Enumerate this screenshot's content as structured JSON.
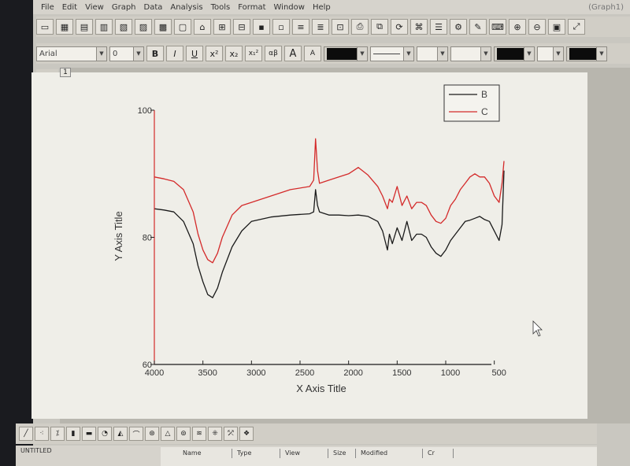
{
  "menu": [
    "File",
    "Edit",
    "View",
    "Graph",
    "Data",
    "Analysis",
    "Tools",
    "Format",
    "Window",
    "Help"
  ],
  "window_title_right": "(Graph1)",
  "format_toolbar": {
    "font_name": "Arial",
    "font_size": "0",
    "bold": "B",
    "italic": "I",
    "underline": "U",
    "superscript": "x²",
    "subscript": "x₂",
    "supsub": "x₁²",
    "greek": "αβ",
    "increase_font": "A",
    "decrease_font": "A"
  },
  "layer_label": "1",
  "project": {
    "name": "UNTITLED",
    "columns": [
      "Name",
      "Type",
      "View",
      "Size",
      "Modified"
    ],
    "dropdown": "Cr"
  },
  "chart_data": {
    "type": "line",
    "xlabel": "X Axis Title",
    "ylabel": "Y Axis Title",
    "xlim": [
      4000,
      400
    ],
    "ylim": [
      60,
      100
    ],
    "x_ticks": [
      4000,
      3500,
      3000,
      2500,
      2000,
      1500,
      1000,
      500
    ],
    "x_tick_labels": [
      "4000",
      "3500",
      "3000",
      "2500",
      "2000",
      "1500",
      "1000",
      "500"
    ],
    "y_ticks": [
      60,
      80,
      100
    ],
    "y_tick_labels": [
      "60",
      "80",
      "100"
    ],
    "grid": false,
    "legend_position": "top-right",
    "series": [
      {
        "name": "B",
        "color": "#1a1a1a",
        "x": [
          4000,
          3900,
          3800,
          3700,
          3600,
          3550,
          3500,
          3450,
          3400,
          3350,
          3300,
          3200,
          3100,
          3000,
          2800,
          2600,
          2400,
          2360,
          2340,
          2320,
          2300,
          2200,
          2100,
          2000,
          1900,
          1800,
          1700,
          1650,
          1600,
          1580,
          1550,
          1500,
          1450,
          1400,
          1350,
          1300,
          1250,
          1200,
          1150,
          1100,
          1050,
          1000,
          950,
          900,
          850,
          800,
          750,
          700,
          650,
          600,
          550,
          500,
          450,
          420,
          400
        ],
        "y": [
          84.5,
          84.3,
          84,
          82.5,
          79,
          75.5,
          73,
          71,
          70.5,
          72,
          74.5,
          78.5,
          81,
          82.5,
          83.2,
          83.5,
          83.7,
          84,
          87.5,
          85,
          84,
          83.5,
          83.5,
          83.4,
          83.5,
          83.3,
          82.5,
          81,
          78,
          80.5,
          79,
          81.5,
          79.5,
          82.5,
          79.5,
          80.5,
          80.5,
          80,
          78.5,
          77.5,
          77,
          78,
          79.5,
          80.5,
          81.5,
          82.5,
          82.7,
          83,
          83.3,
          82.8,
          82.5,
          81,
          79.5,
          82,
          90.5
        ]
      },
      {
        "name": "C",
        "color": "#d42a2a",
        "x": [
          4000,
          3900,
          3800,
          3700,
          3600,
          3550,
          3500,
          3450,
          3400,
          3350,
          3300,
          3200,
          3100,
          3000,
          2800,
          2600,
          2400,
          2360,
          2340,
          2320,
          2300,
          2200,
          2100,
          2000,
          1900,
          1800,
          1700,
          1650,
          1600,
          1580,
          1550,
          1500,
          1450,
          1400,
          1350,
          1300,
          1250,
          1200,
          1150,
          1100,
          1050,
          1000,
          950,
          900,
          850,
          800,
          750,
          700,
          650,
          600,
          550,
          500,
          450,
          420,
          400
        ],
        "y": [
          89.5,
          89.2,
          88.8,
          87.5,
          84,
          80.5,
          78,
          76.5,
          76,
          77.5,
          80,
          83.5,
          85,
          85.5,
          86.5,
          87.5,
          88,
          89,
          95.5,
          90.5,
          88.5,
          89,
          89.5,
          90,
          91,
          89.8,
          88,
          86.5,
          84.5,
          86,
          85.5,
          88,
          85,
          86.5,
          84.5,
          85.5,
          85.5,
          85,
          83.5,
          82.5,
          82.2,
          83,
          85,
          86,
          87.5,
          88.5,
          89.5,
          90,
          89.5,
          89.5,
          88.5,
          86.5,
          85.5,
          88.5,
          92
        ]
      }
    ]
  }
}
